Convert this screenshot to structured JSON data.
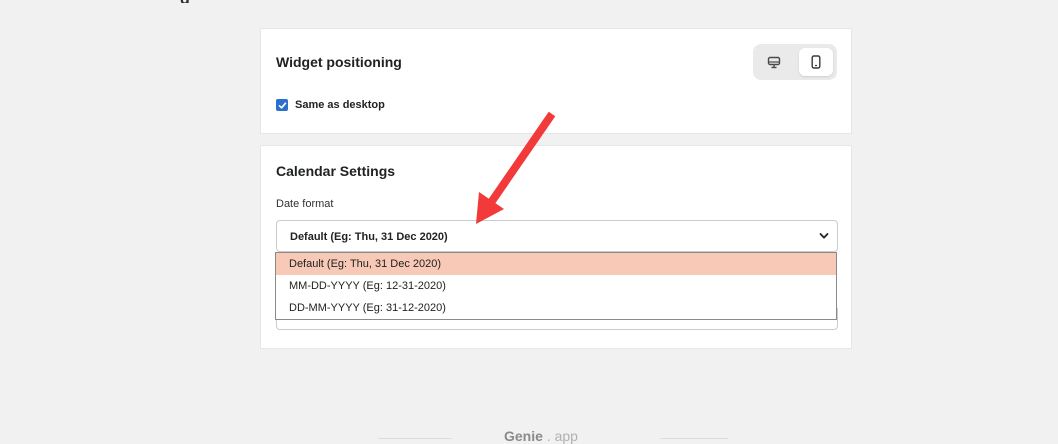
{
  "page": {
    "top_fragment": "g"
  },
  "widget_positioning": {
    "title": "Widget positioning",
    "device_toggle": {
      "desktop_icon": "desktop-icon",
      "mobile_icon": "mobile-icon",
      "active": "mobile"
    },
    "same_as_desktop": {
      "label": "Same as desktop",
      "checked": true
    }
  },
  "calendar_settings": {
    "title": "Calendar Settings",
    "date_format": {
      "label": "Date format",
      "value": "Default (Eg: Thu, 31 Dec 2020)",
      "options": [
        "Default (Eg: Thu, 31 Dec 2020)",
        "MM-DD-YYYY (Eg: 12-31-2020)",
        "DD-MM-YYYY (Eg: 31-12-2020)"
      ],
      "highlighted_option": 0
    }
  },
  "annotation": {
    "arrow_color": "#f23a3a"
  },
  "footer": {
    "brand": "Genie",
    "suffix": " . app"
  },
  "colors": {
    "background": "#f1f1f1",
    "checkbox": "#2c6ecb",
    "option_highlight": "#f8c9b6"
  }
}
